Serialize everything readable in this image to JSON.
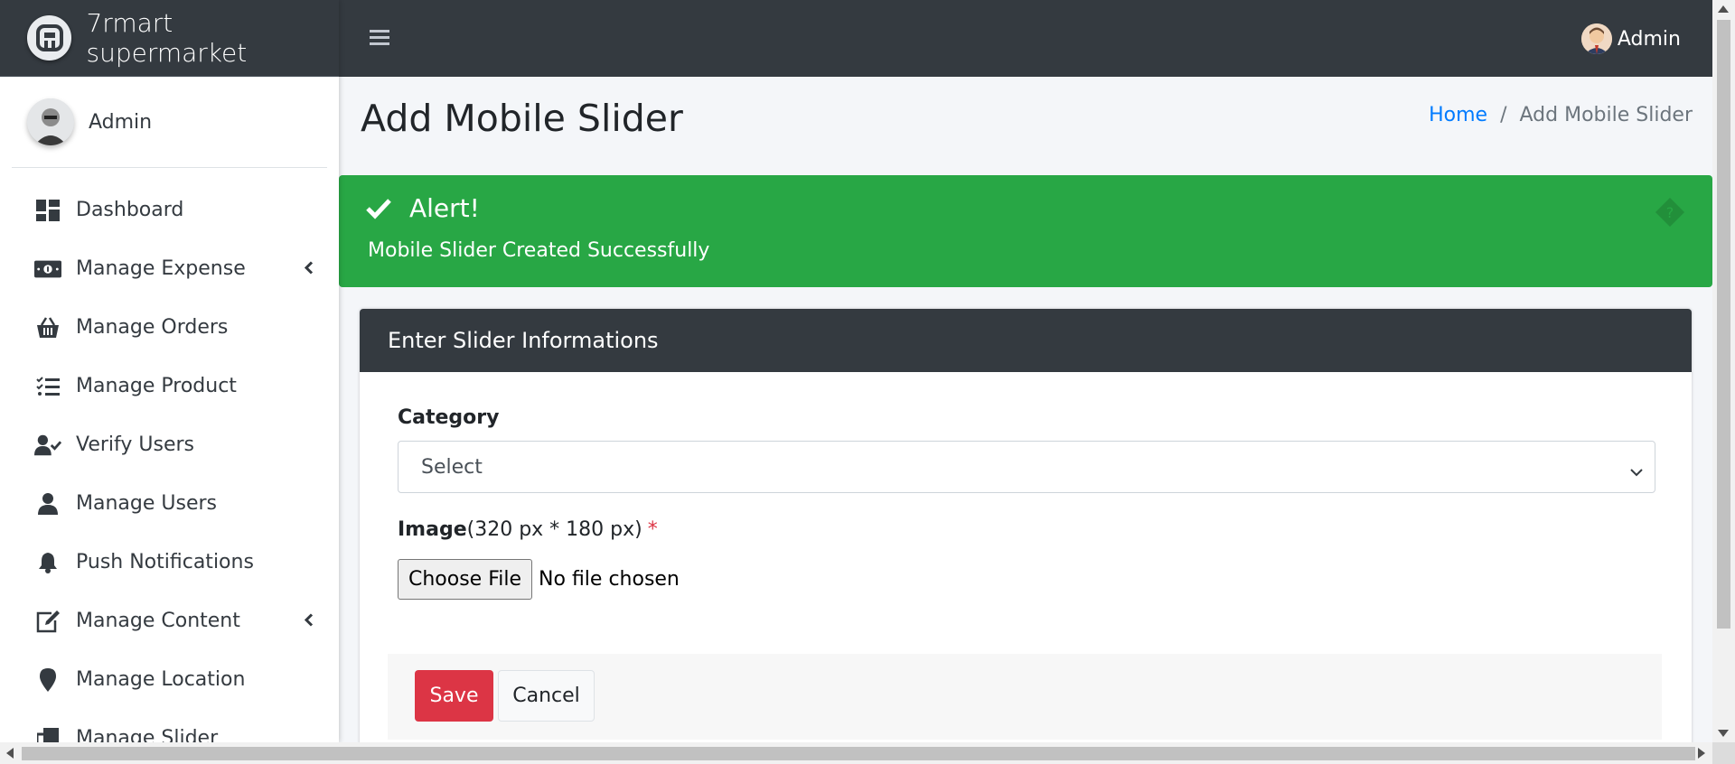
{
  "brand": {
    "name": "7rmart supermarket"
  },
  "sidebar": {
    "user_name": "Admin",
    "items": [
      {
        "label": "Dashboard",
        "icon": "dashboard-icon",
        "has_arrow": false
      },
      {
        "label": "Manage Expense",
        "icon": "money-bill-icon",
        "has_arrow": true
      },
      {
        "label": "Manage Orders",
        "icon": "basket-icon",
        "has_arrow": false
      },
      {
        "label": "Manage Product",
        "icon": "tasks-list-icon",
        "has_arrow": false
      },
      {
        "label": "Verify Users",
        "icon": "user-check-icon",
        "has_arrow": false
      },
      {
        "label": "Manage Users",
        "icon": "user-icon",
        "has_arrow": false
      },
      {
        "label": "Push Notifications",
        "icon": "bell-icon",
        "has_arrow": false
      },
      {
        "label": "Manage Content",
        "icon": "edit-icon",
        "has_arrow": true
      },
      {
        "label": "Manage Location",
        "icon": "map-marker-icon",
        "has_arrow": false
      },
      {
        "label": "Manage Slider",
        "icon": "clone-icon",
        "has_arrow": false
      }
    ]
  },
  "topbar": {
    "user_name": "Admin"
  },
  "page": {
    "title": "Add Mobile Slider",
    "breadcrumb": {
      "home": "Home",
      "separator": "/",
      "current": "Add Mobile Slider"
    }
  },
  "alert": {
    "title": "Alert!",
    "message": "Mobile Slider Created Successfully",
    "color": "#28a745"
  },
  "form": {
    "card_title": "Enter Slider Informations",
    "category_label": "Category",
    "category_value": "Select",
    "image_label": "Image",
    "image_hint": "(320 px * 180 px)",
    "required_mark": "*",
    "file_button": "Choose File",
    "file_status": "No file chosen",
    "save_label": "Save",
    "cancel_label": "Cancel"
  },
  "colors": {
    "dark": "#343a40",
    "save": "#dc3545",
    "link": "#007bff"
  }
}
